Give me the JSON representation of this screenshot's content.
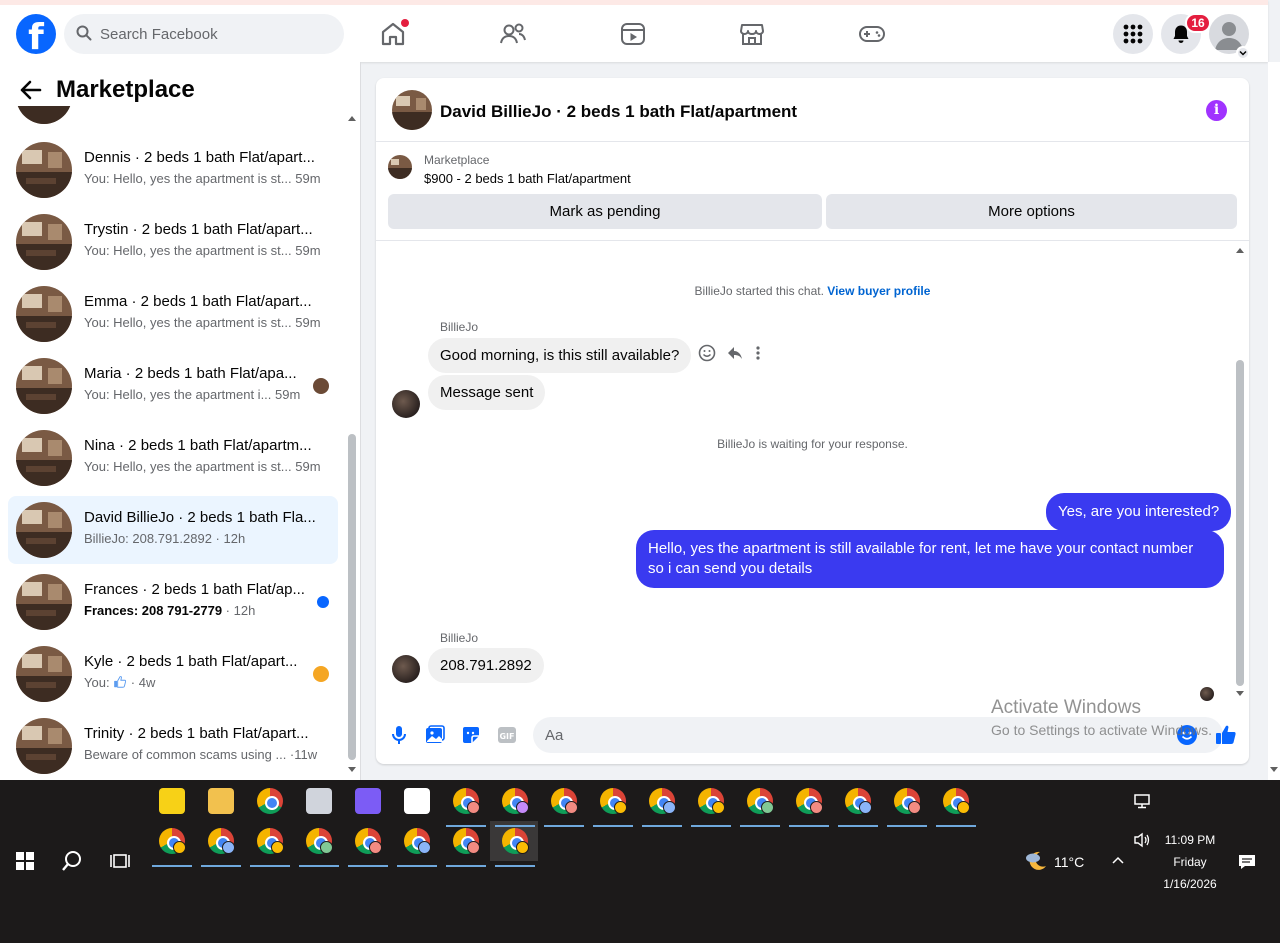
{
  "header": {
    "search_placeholder": "Search Facebook",
    "notification_count": "16",
    "nav_icons": [
      "home-icon",
      "friends-icon",
      "video-icon",
      "marketplace-icon",
      "gaming-icon"
    ]
  },
  "sidebar": {
    "title": "Marketplace",
    "conversations": [
      {
        "name": "Dennis · 2 beds 1 bath Flat/apart...",
        "preview": "You: Hello, yes the apartment is st...",
        "time": "59m"
      },
      {
        "name": "Trystin · 2 beds 1 bath Flat/apart...",
        "preview": "You: Hello, yes the apartment is st...",
        "time": "59m"
      },
      {
        "name": "Emma · 2 beds 1 bath Flat/apart...",
        "preview": "You: Hello, yes the apartment is st...",
        "time": "59m"
      },
      {
        "name": "Maria · 2 beds 1 bath Flat/apa...",
        "preview": "You: Hello, yes the apartment i...",
        "time": "59m"
      },
      {
        "name": "Nina · 2 beds 1 bath Flat/apartm...",
        "preview": "You: Hello, yes the apartment is st...",
        "time": "59m"
      },
      {
        "name": "David BillieJo · 2 beds 1 bath Fla...",
        "preview": "BillieJo: 208.791.2892",
        "time": "12h"
      },
      {
        "name": "Frances · 2 beds 1 bath Flat/ap...",
        "preview": "Frances: 208 791-2779",
        "time": "12h"
      },
      {
        "name": "Kyle · 2 beds 1 bath Flat/apart...",
        "preview": "You:",
        "time": "4w"
      },
      {
        "name": "Trinity · 2 beds 1 bath Flat/apart...",
        "preview": "Beware of common scams using ...",
        "time": "11w"
      }
    ]
  },
  "chat": {
    "title": "David BillieJo · 2 beds 1 bath Flat/apartment",
    "listing_label": "Marketplace",
    "listing_price": "$900 - 2 beds 1 bath Flat/apartment",
    "mark_pending_label": "Mark as pending",
    "more_options_label": "More options",
    "started_text": "BillieJo started this chat.",
    "view_profile_label": "View buyer profile",
    "sender_name": "BillieJo",
    "msg1": "Good morning, is this still available?",
    "msg2": "Message sent",
    "waiting_text": "BillieJo is waiting for your response.",
    "out1": "Yes, are you interested?",
    "out2": "Hello, yes the apartment is still available for rent, let me have your contact number so i can send you details",
    "msg3": "208.791.2892",
    "composer_placeholder": "Aa"
  },
  "watermark": {
    "line1": "Activate Windows",
    "line2": "Go to Settings to activate Windows."
  },
  "taskbar": {
    "temperature": "11°C",
    "time": "11:09 PM",
    "day": "Friday",
    "date": "1/16/2026"
  },
  "colors": {
    "brand": "#0866ff",
    "outgoing_bubble": "#3a3af0",
    "badge": "#e41e3f",
    "info": "#a033ff"
  }
}
